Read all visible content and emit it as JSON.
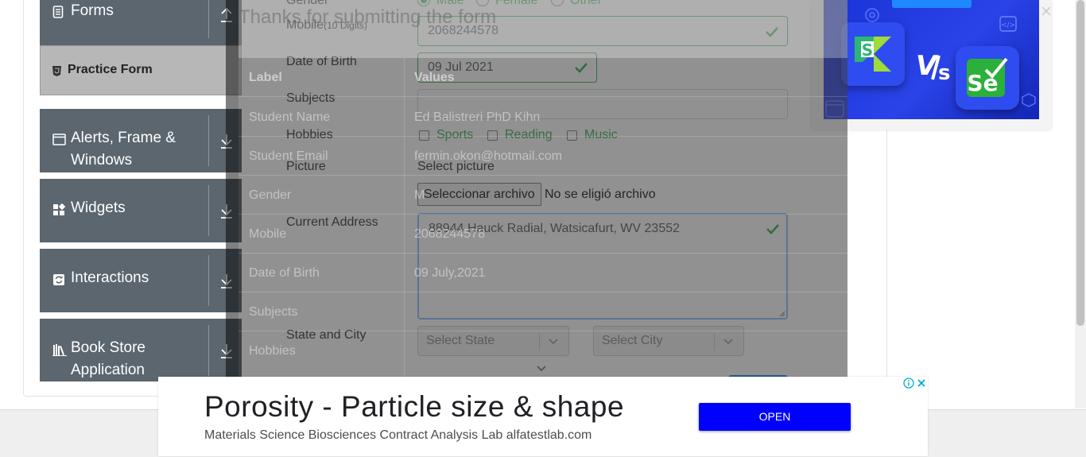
{
  "sidebar": {
    "groups": [
      {
        "label": "Forms",
        "icon": "document-icon"
      },
      {
        "label": "Alerts, Frame & Windows",
        "icon": "window-icon"
      },
      {
        "label": "Widgets",
        "icon": "widgets-icon"
      },
      {
        "label": "Interactions",
        "icon": "interactions-icon"
      },
      {
        "label": "Book Store Application",
        "icon": "books-icon"
      }
    ],
    "active_item": "Practice Form"
  },
  "form": {
    "gender_label": "Gender",
    "gender_options": [
      "Male",
      "Female",
      "Other"
    ],
    "mobile_label": "Mobile",
    "mobile_hint": "(10 Digits)",
    "mobile_value": "2068244578",
    "dob_label": "Date of Birth",
    "dob_value": "09 Jul 2021",
    "subjects_label": "Subjects",
    "subjects_value": "",
    "hobbies_label": "Hobbies",
    "hobbies": [
      "Sports",
      "Reading",
      "Music"
    ],
    "picture_label": "Picture",
    "picture_caption": "Select picture",
    "file_button": "Seleccionar archivo",
    "file_status": "No se eligió archivo",
    "address_label": "Current Address",
    "address_value": "88944 Hauck Radial, Watsicafurt, WV 23552",
    "state_city_label": "State and City",
    "state_placeholder": "Select State",
    "city_placeholder": "Select City"
  },
  "modal": {
    "title": "Thanks for submitting the form",
    "headers": {
      "label": "Label",
      "values": "Values"
    },
    "rows": [
      {
        "label": "Student Name",
        "value": "Ed Balistreri PhD Kihn"
      },
      {
        "label": "Student Email",
        "value": "fermin.okon@hotmail.com"
      },
      {
        "label": "Gender",
        "value": "M"
      },
      {
        "label": "Mobile",
        "value": "2068244578"
      },
      {
        "label": "Date of Birth",
        "value": "09 July,2021"
      },
      {
        "label": "Subjects",
        "value": ""
      },
      {
        "label": "Hobbies",
        "value": ""
      }
    ]
  },
  "ad_banner": {
    "headline": "Porosity - Particle size & shape",
    "subline": "Materials Science Biosciences Contract Analysis Lab alfatestlab.com",
    "button": "OPEN"
  },
  "colors": {
    "sidebar_group": "#5b666f",
    "valid_green": "#28a745",
    "ad_button": "#0000ff",
    "ad_image_blue": "#2a43e8"
  }
}
